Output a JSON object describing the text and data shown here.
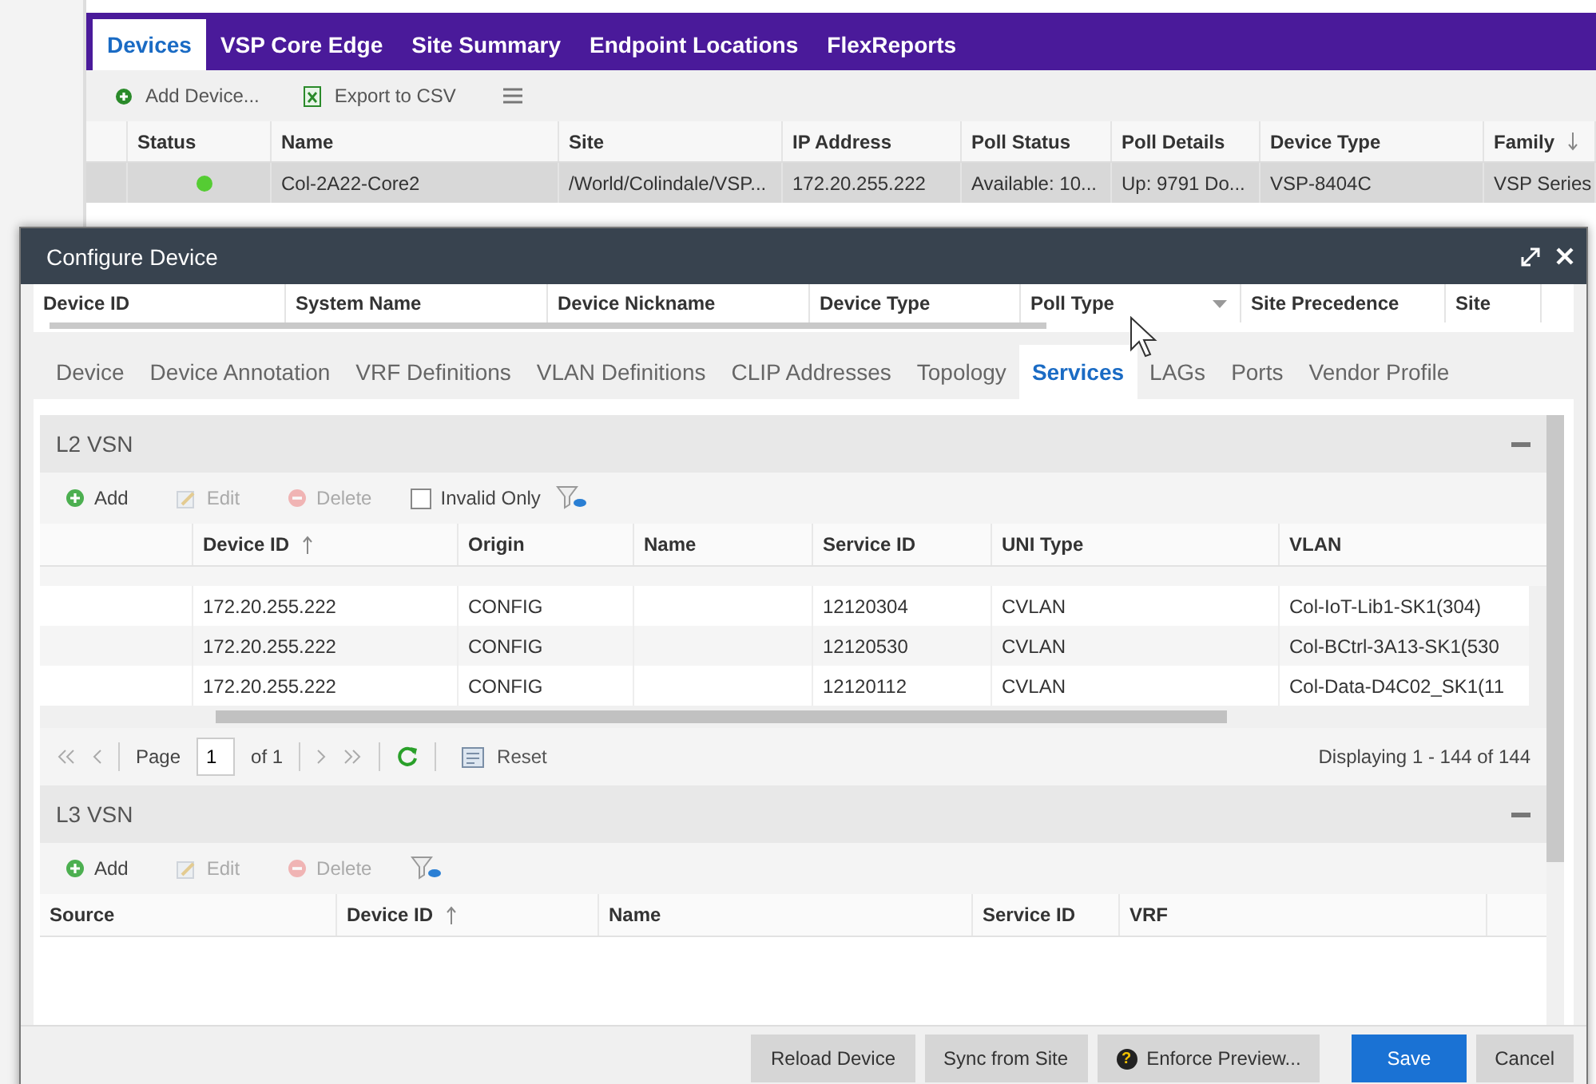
{
  "main_tabs": [
    {
      "label": "Devices",
      "selected": true
    },
    {
      "label": "VSP Core Edge",
      "selected": false
    },
    {
      "label": "Site Summary",
      "selected": false
    },
    {
      "label": "Endpoint Locations",
      "selected": false
    },
    {
      "label": "FlexReports",
      "selected": false
    }
  ],
  "main_toolbar": [
    {
      "label": "Add Device...",
      "kind": "add"
    },
    {
      "label": "Export to CSV",
      "kind": "export"
    }
  ],
  "device_table": {
    "columns": [
      {
        "label": "Status",
        "sorted": false
      },
      {
        "label": "Name",
        "sorted": false
      },
      {
        "label": "Site",
        "sorted": false
      },
      {
        "label": "IP Address",
        "sorted": false
      },
      {
        "label": "Poll Status",
        "sorted": false
      },
      {
        "label": "Poll Details",
        "sorted": false
      },
      {
        "label": "Device Type",
        "sorted": false
      },
      {
        "label": "Family",
        "sorted": true
      }
    ],
    "rows": [
      {
        "color": "#55cc33",
        "selected": true,
        "cells": [
          "",
          "Col-2A22-Core2",
          "/World/Colindale/VSP...",
          "172.20.255.222",
          "Available: 10...",
          "Up: 9791 Do...",
          "VSP-8404C",
          "VSP Series"
        ]
      }
    ]
  },
  "dialog": {
    "title": "Configure Device",
    "columns": [
      "Device ID",
      "System Name",
      "Device Nickname",
      "Device Type",
      "Poll Type",
      "Site Precedence",
      "Site"
    ],
    "tabs": [
      {
        "label": "Device",
        "selected": false
      },
      {
        "label": "Device Annotation",
        "selected": false
      },
      {
        "label": "VRF Definitions",
        "selected": false
      },
      {
        "label": "VLAN Definitions",
        "selected": false
      },
      {
        "label": "CLIP Addresses",
        "selected": false
      },
      {
        "label": "Topology",
        "selected": false
      },
      {
        "label": "Services",
        "selected": true
      },
      {
        "label": "LAGs",
        "selected": false
      },
      {
        "label": "Ports",
        "selected": false
      },
      {
        "label": "Vendor Profile",
        "selected": false
      }
    ],
    "l2_vsn": {
      "title": "L2 VSN",
      "toolbar": [
        {
          "label": "Add",
          "kind": "add",
          "disabled": false
        },
        {
          "label": "Edit",
          "kind": "edit",
          "disabled": true
        },
        {
          "label": "Delete",
          "kind": "delete",
          "disabled": true
        }
      ],
      "invalid_only": {
        "label": "Invalid Only",
        "checked": false
      },
      "columns": [
        {
          "label": "Device ID",
          "sorted": true
        },
        {
          "label": "Origin",
          "sorted": false
        },
        {
          "label": "Name",
          "sorted": false
        },
        {
          "label": "Service ID",
          "sorted": false
        },
        {
          "label": "UNI Type",
          "sorted": false
        },
        {
          "label": "VLAN",
          "sorted": false
        }
      ],
      "rows": [
        [
          "172.20.255.222",
          "CONFIG",
          "",
          "12120304",
          "CVLAN",
          "Col-IoT-Lib1-SK1(304)"
        ],
        [
          "172.20.255.222",
          "CONFIG",
          "",
          "12120530",
          "CVLAN",
          "Col-BCtrl-3A13-SK1(530"
        ],
        [
          "172.20.255.222",
          "CONFIG",
          "",
          "12120112",
          "CVLAN",
          "Col-Data-D4C02_SK1(11"
        ]
      ],
      "pager": {
        "page_label": "Page",
        "page": "1",
        "of": "of 1",
        "reset": "Reset",
        "displaying": "Displaying 1 - 144 of 144"
      }
    },
    "l3_vsn": {
      "title": "L3 VSN",
      "toolbar": [
        {
          "label": "Add",
          "kind": "add",
          "disabled": false
        },
        {
          "label": "Edit",
          "kind": "edit",
          "disabled": true
        },
        {
          "label": "Delete",
          "kind": "delete",
          "disabled": true
        }
      ],
      "columns": [
        {
          "label": "Source",
          "sorted": false
        },
        {
          "label": "Device ID",
          "sorted": true
        },
        {
          "label": "Name",
          "sorted": false
        },
        {
          "label": "Service ID",
          "sorted": false
        },
        {
          "label": "VRF",
          "sorted": false
        }
      ]
    },
    "buttons": [
      {
        "label": "Reload Device",
        "kind": "normal"
      },
      {
        "label": "Sync from Site",
        "kind": "normal"
      },
      {
        "label": "Enforce Preview...",
        "kind": "help",
        "icon": "?"
      },
      {
        "label": "Save",
        "kind": "primary"
      },
      {
        "label": "Cancel",
        "kind": "normal"
      }
    ]
  }
}
